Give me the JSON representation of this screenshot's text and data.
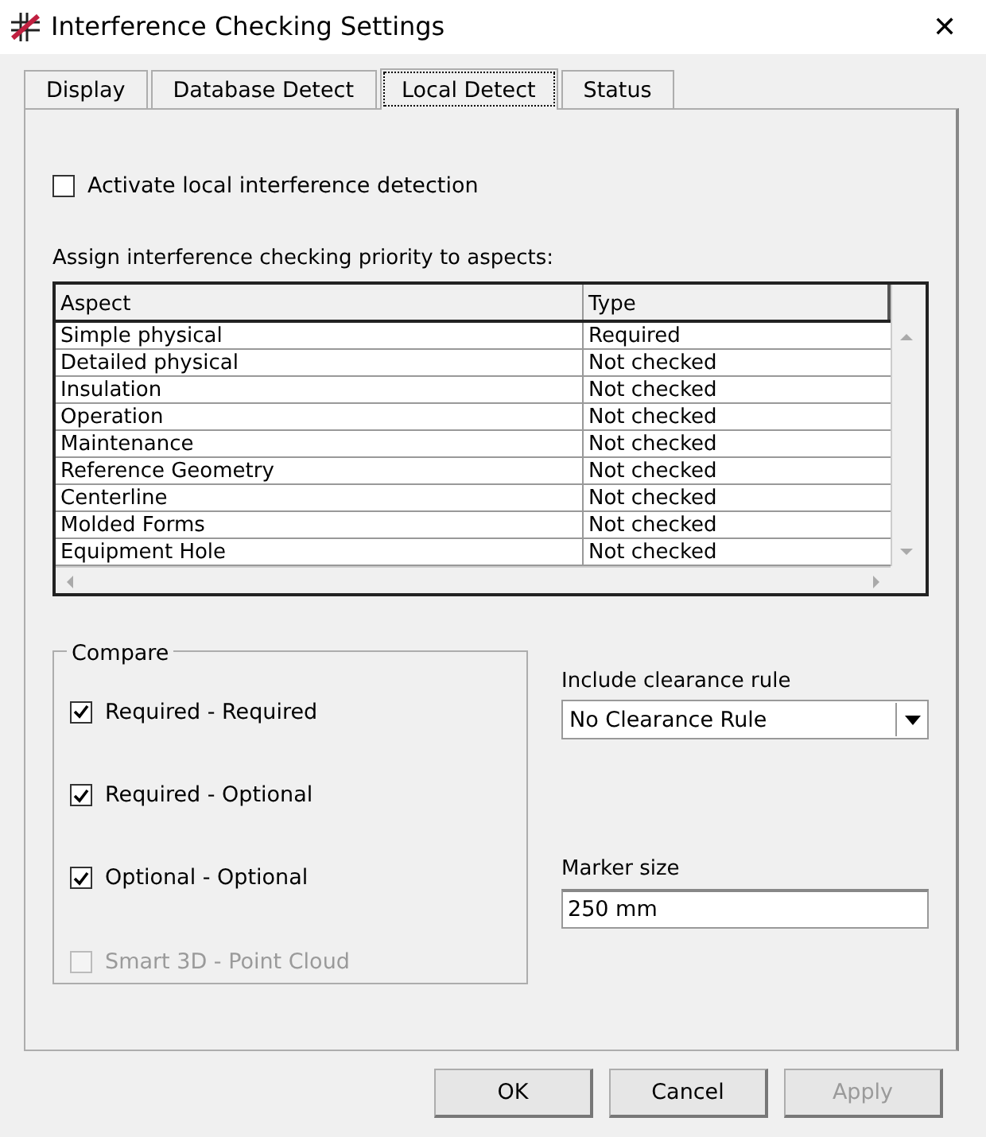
{
  "window": {
    "title": "Interference Checking Settings",
    "close": "✕"
  },
  "tabs": [
    {
      "label": "Display",
      "selected": false
    },
    {
      "label": "Database Detect",
      "selected": false
    },
    {
      "label": "Local Detect",
      "selected": true
    },
    {
      "label": "Status",
      "selected": false
    }
  ],
  "activate": {
    "label": "Activate local interference detection",
    "checked": false
  },
  "table": {
    "caption": "Assign interference checking priority to aspects:",
    "columns": [
      "Aspect",
      "Type"
    ],
    "rows": [
      [
        "Simple physical",
        "Required"
      ],
      [
        "Detailed physical",
        "Not checked"
      ],
      [
        "Insulation",
        "Not checked"
      ],
      [
        "Operation",
        "Not checked"
      ],
      [
        "Maintenance",
        "Not checked"
      ],
      [
        "Reference Geometry",
        "Not checked"
      ],
      [
        "Centerline",
        "Not checked"
      ],
      [
        "Molded Forms",
        "Not checked"
      ],
      [
        "Equipment Hole",
        "Not checked"
      ]
    ]
  },
  "compare": {
    "title": "Compare",
    "items": [
      {
        "label": "Required - Required",
        "checked": true,
        "disabled": false
      },
      {
        "label": "Required - Optional",
        "checked": true,
        "disabled": false
      },
      {
        "label": "Optional - Optional",
        "checked": true,
        "disabled": false
      },
      {
        "label": "Smart 3D - Point Cloud",
        "checked": false,
        "disabled": true
      }
    ]
  },
  "clearance": {
    "label": "Include clearance rule",
    "value": "No Clearance Rule"
  },
  "marker": {
    "label": "Marker size",
    "value": "250 mm"
  },
  "buttons": [
    {
      "label": "OK",
      "disabled": false
    },
    {
      "label": "Cancel",
      "disabled": false
    },
    {
      "label": "Apply",
      "disabled": true
    }
  ]
}
